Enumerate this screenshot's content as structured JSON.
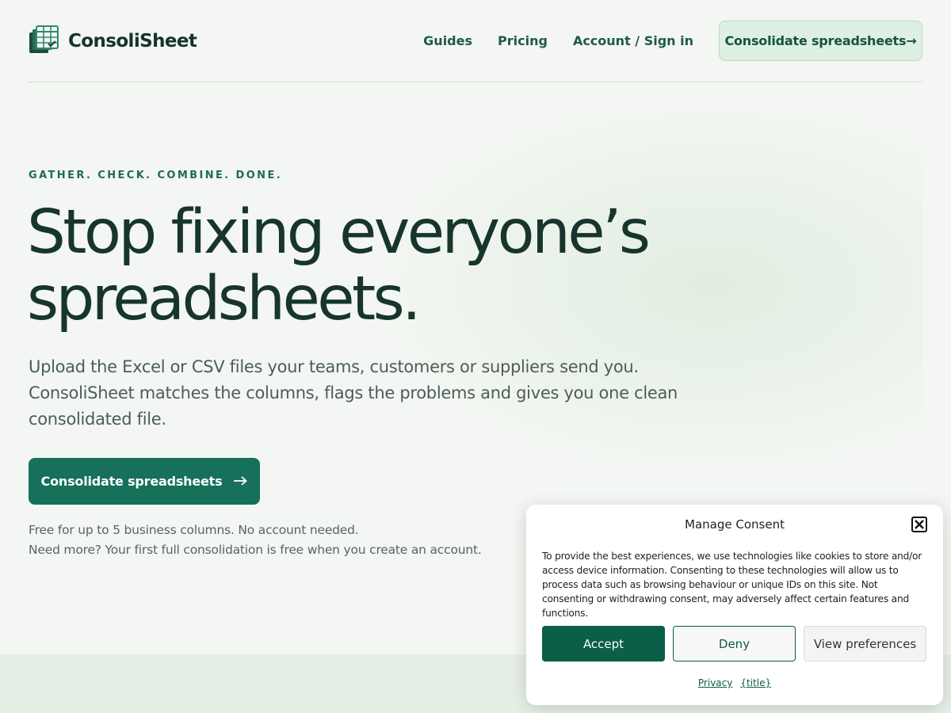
{
  "brand": {
    "name": "ConsoliSheet",
    "icon": "spreadsheet-stack-icon"
  },
  "nav": {
    "links": [
      "Guides",
      "Pricing",
      "Account / Sign in"
    ],
    "cta": "Consolidate spreadsheets→"
  },
  "hero": {
    "eyebrow": "GATHER. CHECK. COMBINE. DONE.",
    "title_line1": "Stop fixing everyone’s",
    "title_line2": "spreadsheets.",
    "lead": "Upload the Excel or CSV files your teams, customers or suppliers send you. ConsoliSheet matches the columns, flags the problems and gives you one clean consolidated file.",
    "cta": "Consolidate spreadsheets",
    "cta_icon": "arrow-right-icon",
    "note_line1": "Free for up to 5 business columns. No account needed.",
    "note_line2": "Need more? Your first full consolidation is free when you create an account."
  },
  "consent": {
    "title": "Manage Consent",
    "body": "To provide the best experiences, we use technologies like cookies to store and/or access device information. Consenting to these technologies will allow us to process data such as browsing behaviour or unique IDs on this site. Not consenting or withdrawing consent, may adversely affect certain features and functions.",
    "accept": "Accept",
    "deny": "Deny",
    "preferences": "View preferences",
    "links": [
      "Privacy",
      "{title}"
    ]
  },
  "colors": {
    "accent": "#16705a",
    "background": "#f3f6f2",
    "heading": "#17352d"
  }
}
